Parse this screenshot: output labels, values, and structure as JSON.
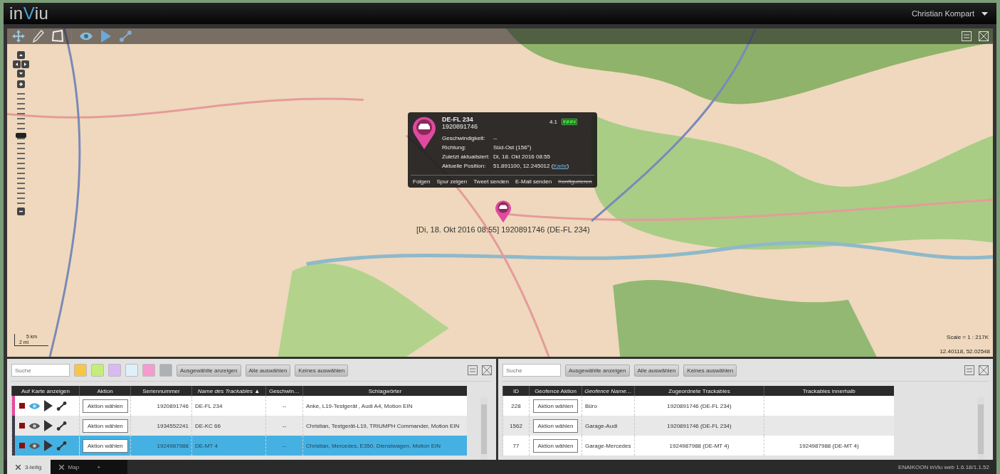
{
  "header": {
    "logo": [
      {
        "text": "in",
        "accent": false
      },
      {
        "text": "V",
        "accent": true
      },
      {
        "text": "iu",
        "accent": false
      }
    ],
    "user": "Christian Kompart"
  },
  "map": {
    "zoom": {
      "level": 0.6
    },
    "popup": {
      "title": "DE-FL 234",
      "serial": "1920891746",
      "signal": "4.1",
      "battery": {
        "level": 1
      },
      "fields": [
        {
          "label": "Geschwindigkeit:",
          "value": "--"
        },
        {
          "label": "Richtung:",
          "value": "Süd-Ost (156°)"
        },
        {
          "label": "Zuletzt aktualisiert:",
          "value": "Di, 18. Okt 2016 08:55"
        },
        {
          "label": "Aktuelle Position:",
          "value": "51.891100, 12.245012 (",
          "link": "Karte",
          "suffix": ")"
        }
      ],
      "actions": [
        {
          "label": "Folgen",
          "disabled": false
        },
        {
          "label": "Spur zeigen",
          "disabled": false
        },
        {
          "label": "Tweet senden",
          "disabled": false
        },
        {
          "label": "E-Mail senden",
          "disabled": false
        },
        {
          "label": "Konfigurieren",
          "disabled": true
        }
      ]
    },
    "marker_label": "[Di, 18. Okt 2016 08:55] 1920891746 (DE-FL 234)",
    "scale_bar": {
      "km": "5 km",
      "mi": "2 mi"
    },
    "scale": "Scale = 1 : 217K",
    "coordinates": "12.40118, 52.02548"
  },
  "left_panel": {
    "search": {
      "placeholder": "Suche"
    },
    "swatches": [
      {
        "color": "#f7c548"
      },
      {
        "color": "#c4ee78"
      },
      {
        "color": "#dab8f2"
      },
      {
        "color": "#dff0fb"
      },
      {
        "color": "#f49ccf"
      },
      {
        "color": "#adb1b5"
      }
    ],
    "buttons": [
      "Ausgewählte anzeigen",
      "Alle auswählen",
      "Keines auswählen"
    ],
    "columns": [
      {
        "label": "Auf Karte anzeigen",
        "sorted": false
      },
      {
        "label": "Aktion",
        "sorted": false
      },
      {
        "label": "Seriennummer",
        "sorted": false
      },
      {
        "label": "Name des Trackables",
        "sorted": true,
        "sort_indicator": "▲"
      },
      {
        "label": "Geschwin…",
        "sorted": false
      },
      {
        "label": "Schlagwörter",
        "sorted": false
      }
    ],
    "rows": [
      {
        "color": "#e8489f",
        "visible": true,
        "selected": false,
        "action": "Aktion wählen",
        "serial": "1920891746",
        "name": "DE-FL 234",
        "speed": "--",
        "tags": "Anke, L19-Testgerät , Audi A4, Motion EIN"
      },
      {
        "color": "#3b3b48",
        "visible": false,
        "selected": false,
        "action": "Aktion wählen",
        "serial": "1934552241",
        "name": "DE-KC 66",
        "speed": "--",
        "tags": "Christian, Testgerät-L19, TRIUMPH Commander, Motion EIN"
      },
      {
        "color": "#3b3b48",
        "visible": false,
        "selected": true,
        "action": "Aktion wählen",
        "serial": "1924987988",
        "name": "DE-MT 4",
        "speed": "--",
        "tags": "Christian, Mercedes, E350, Dienstwagen, Motion EIN"
      }
    ]
  },
  "right_panel": {
    "search": {
      "placeholder": "Suche"
    },
    "buttons": [
      "Ausgewählte anzeigen",
      "Alle auswählen",
      "Keines auswählen"
    ],
    "columns": [
      {
        "label": "ID",
        "sorted": false
      },
      {
        "label": "Geofence Aktion",
        "sorted": false
      },
      {
        "label": "Geofence Name…",
        "sorted": true
      },
      {
        "label": "Zugeordnete Trackables",
        "sorted": false
      },
      {
        "label": "Trackables innerhalb",
        "sorted": false
      }
    ],
    "rows": [
      {
        "id": "228",
        "action": "Aktion wählen",
        "name": "Büro",
        "assigned": "1920891746 (DE-FL 234)"
      },
      {
        "id": "1562",
        "action": "Aktion wählen",
        "name": "Garage-Audi",
        "assigned": "1920891746 (DE-FL 234)"
      },
      {
        "id": "77",
        "action": "Aktion wählen",
        "name": "Garage-Mercedes",
        "assigned": "1924987988 (DE-MT 4)",
        "inside": "1924987988 (DE-MT 4)"
      }
    ]
  },
  "tabs": [
    {
      "label": "3-teilig",
      "selected": true,
      "closable": true
    },
    {
      "label": "Map",
      "selected": false,
      "closable": true
    },
    {
      "label": "+",
      "selected": false,
      "closable": false
    }
  ],
  "footer": "ENAIKOON inViu web 1.6.18/1.1.52"
}
